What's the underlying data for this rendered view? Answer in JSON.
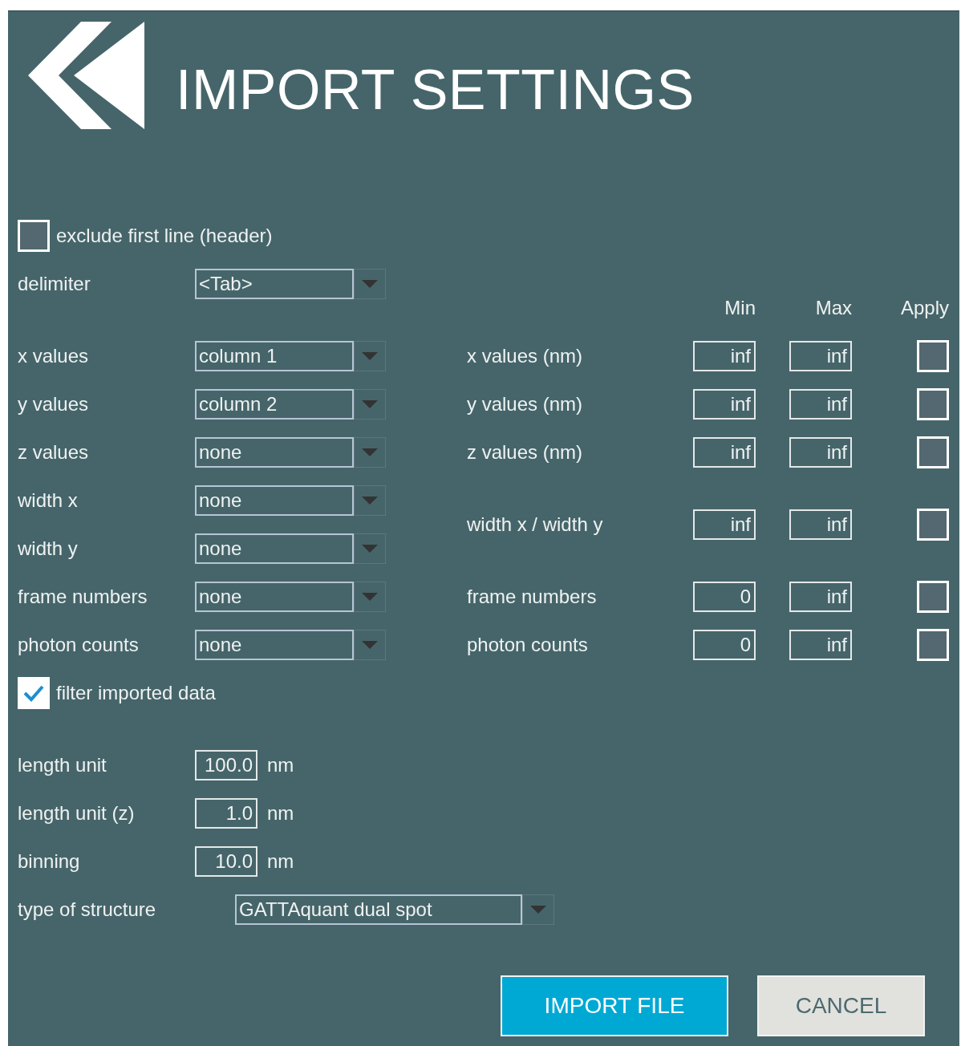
{
  "title": "IMPORT SETTINGS",
  "exclude_header": {
    "label": "exclude first line (header)",
    "checked": false
  },
  "delimiter": {
    "label": "delimiter",
    "value": "<Tab>"
  },
  "filter_header": {
    "min": "Min",
    "max": "Max",
    "apply": "Apply"
  },
  "columns": [
    {
      "label": "x values",
      "value": "column 1"
    },
    {
      "label": "y values",
      "value": "column 2"
    },
    {
      "label": "z values",
      "value": "none"
    },
    {
      "label": "width x",
      "value": "none"
    },
    {
      "label": "width y",
      "value": "none"
    },
    {
      "label": "frame numbers",
      "value": "none"
    },
    {
      "label": "photon counts",
      "value": "none"
    }
  ],
  "filters": [
    {
      "label": "x values (nm)",
      "min": "inf",
      "max": "inf",
      "apply": false
    },
    {
      "label": "y values (nm)",
      "min": "inf",
      "max": "inf",
      "apply": false
    },
    {
      "label": "z values (nm)",
      "min": "inf",
      "max": "inf",
      "apply": false
    },
    {
      "label": "width x / width y",
      "min": "inf",
      "max": "inf",
      "apply": false
    },
    {
      "label": "frame numbers",
      "min": "0",
      "max": "inf",
      "apply": false
    },
    {
      "label": "photon counts",
      "min": "0",
      "max": "inf",
      "apply": false
    }
  ],
  "filter_imported": {
    "label": "filter imported data",
    "checked": true
  },
  "units": [
    {
      "label": "length unit",
      "value": "100.0",
      "unit": "nm"
    },
    {
      "label": "length unit (z)",
      "value": "1.0",
      "unit": "nm"
    },
    {
      "label": "binning",
      "value": "10.0",
      "unit": "nm"
    }
  ],
  "structure": {
    "label": "type of structure",
    "value": "GATTAquant dual spot"
  },
  "buttons": [
    {
      "label": "IMPORT FILE",
      "kind": "primary"
    },
    {
      "label": "CANCEL",
      "kind": "secondary"
    }
  ]
}
